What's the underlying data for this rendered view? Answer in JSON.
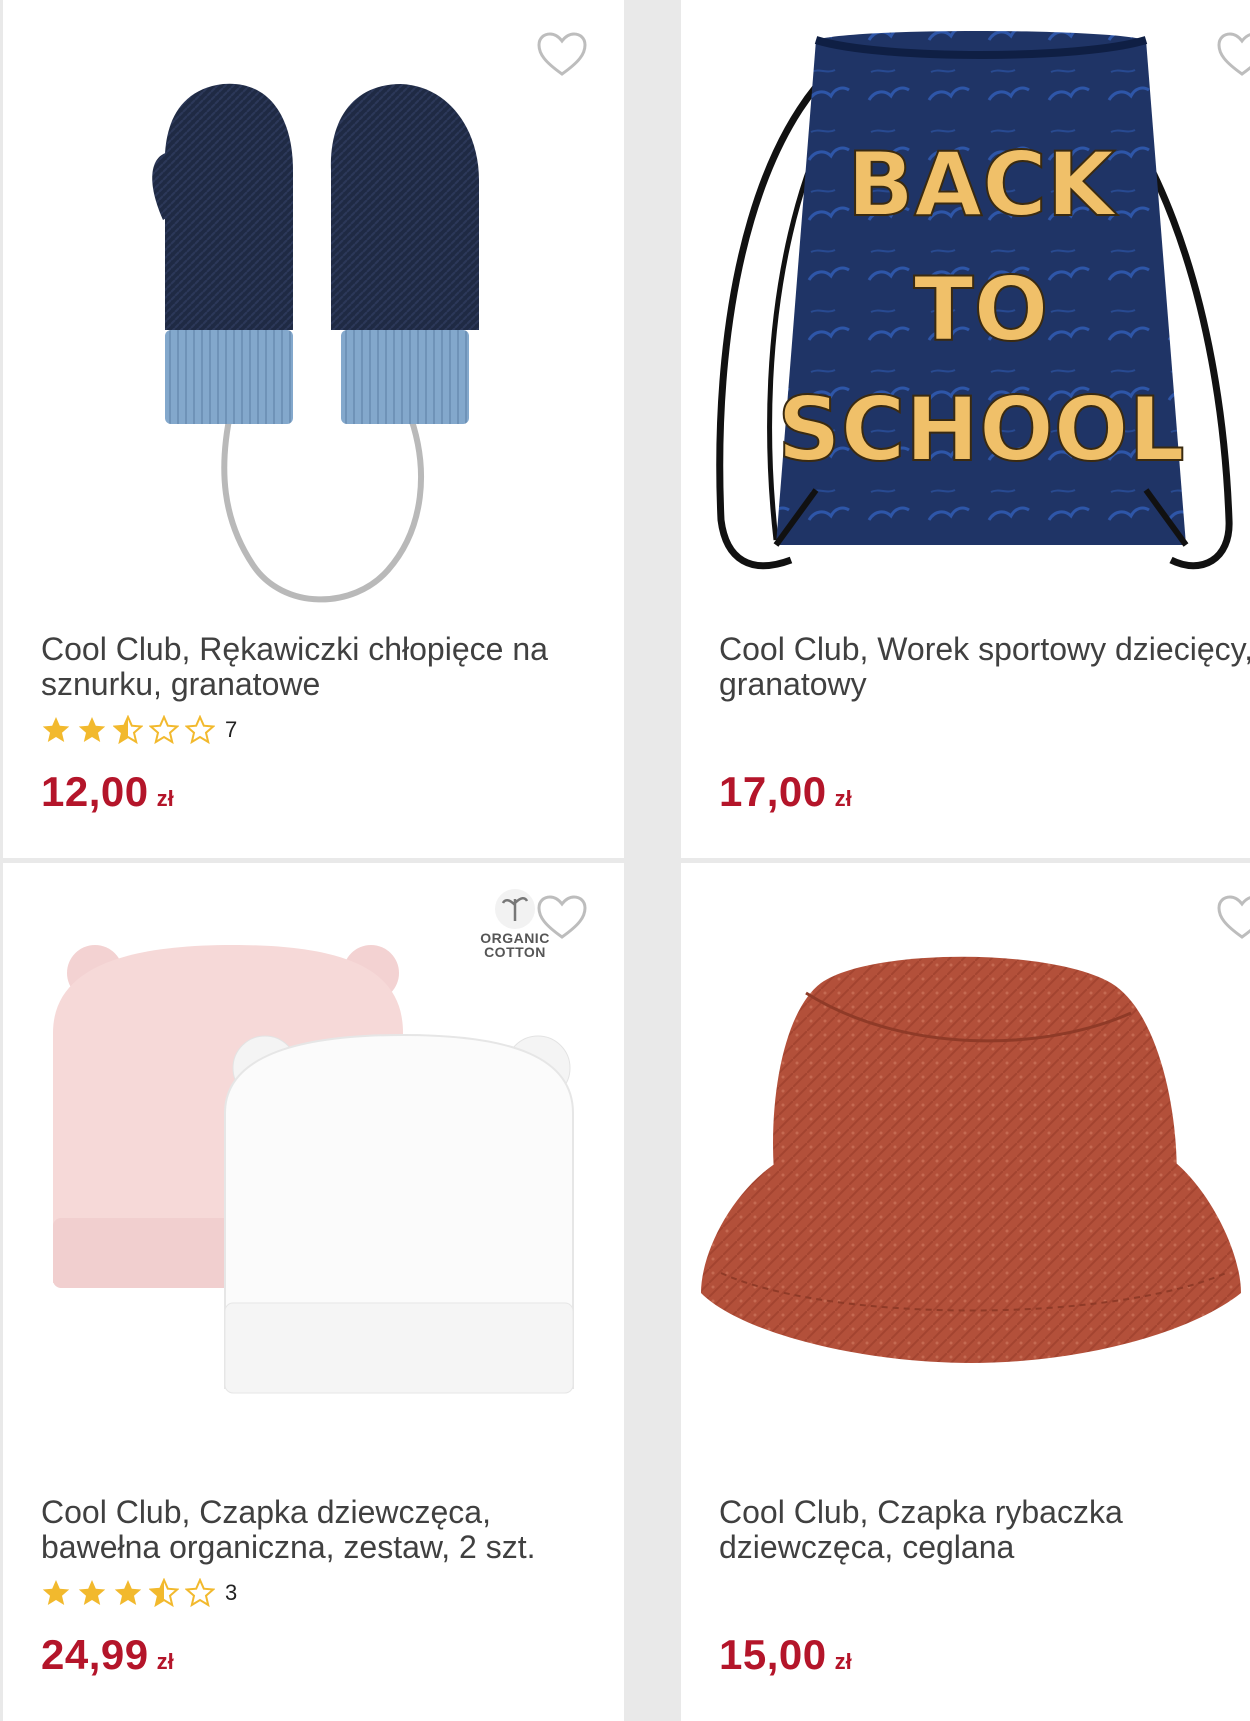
{
  "products": [
    {
      "title": "Cool Club, Rękawiczki chłopięce na sznurku, granatowe",
      "image": "navy-knit-mittens-on-string",
      "rating": 2.5,
      "rating_count": "7",
      "price": "12,00",
      "currency": "zł"
    },
    {
      "title": "Cool Club, Worek sportowy dziecięcy, granatowy",
      "image": "navy-drawstring-bag-back-to-school",
      "bag_print": [
        "BACK",
        "TO",
        "SCHOOL"
      ],
      "price": "17,00",
      "currency": "zł"
    },
    {
      "title": "Cool Club, Czapka dziewczęca, bawełna organiczna, zestaw, 2 szt.",
      "image": "pink-and-white-baby-hats-with-ears",
      "badge": [
        "ORGANIC",
        "COTTON"
      ],
      "rating": 3.5,
      "rating_count": "3",
      "price": "24,99",
      "currency": "zł"
    },
    {
      "title": "Cool Club, Czapka rybaczka dziewczęca, ceglana",
      "image": "brick-red-bucket-hat",
      "price": "15,00",
      "currency": "zł"
    }
  ],
  "icons": {
    "favorite": "heart-outline-icon",
    "star_full": "star-filled-icon",
    "star_half": "star-half-icon",
    "star_empty": "star-outline-icon"
  },
  "colors": {
    "price": "#b4152a",
    "star": "#f2b92d",
    "title": "#404040",
    "background": "#e9e9e9"
  }
}
